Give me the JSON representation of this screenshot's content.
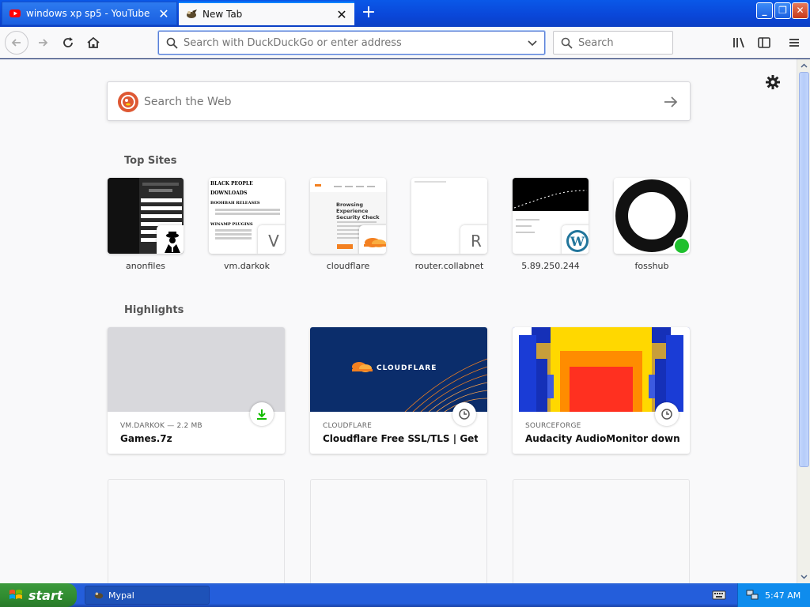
{
  "tabs": [
    {
      "label": "windows xp sp5 - YouTube",
      "active": false,
      "favicon": "youtube-icon"
    },
    {
      "label": "New Tab",
      "active": true,
      "favicon": "mypal-icon"
    }
  ],
  "navbar": {
    "url_placeholder": "Search with DuckDuckGo or enter address",
    "search_placeholder": "Search"
  },
  "newtab": {
    "web_search_placeholder": "Search the Web",
    "top_sites_title": "Top Sites",
    "highlights_title": "Highlights",
    "top_sites": [
      {
        "label": "anonfiles",
        "badge": ""
      },
      {
        "label": "vm.darkok",
        "badge": "V"
      },
      {
        "label": "cloudflare",
        "badge": ""
      },
      {
        "label": "router.collabnet",
        "badge": "R"
      },
      {
        "label": "5.89.250.244",
        "badge": ""
      },
      {
        "label": "fosshub",
        "badge": ""
      }
    ],
    "vm_thumb_lines": [
      "BLACK PEOPLE",
      "DOWNLOADS",
      "BOOHBAH RELEASES",
      "WINAMP PLUGINS"
    ],
    "cloudflare_thumb_lines": [
      "Browsing Experience",
      "Security Check"
    ],
    "highlights": [
      {
        "source": "VM.DARKOK — 2.2 MB",
        "title": "Games.7z",
        "icon": "download-icon"
      },
      {
        "source": "CLOUDFLARE",
        "title": "Cloudflare Free SSL/TLS | Get SS...",
        "icon": "clock-icon",
        "logo_text": "CLOUDFLARE"
      },
      {
        "source": "SOURCEFORGE",
        "title": "Audacity AudioMonitor downloa...",
        "icon": "clock-icon"
      }
    ]
  },
  "taskbar": {
    "start_label": "start",
    "task_label": "Mypal",
    "clock": "5:47 AM"
  },
  "colors": {
    "accent": "#0a84ff",
    "xp_blue": "#245edb",
    "start_green": "#2f8b2f",
    "cloudflare_orange": "#f38020",
    "cloudflare_navy": "#0b2d6b"
  }
}
